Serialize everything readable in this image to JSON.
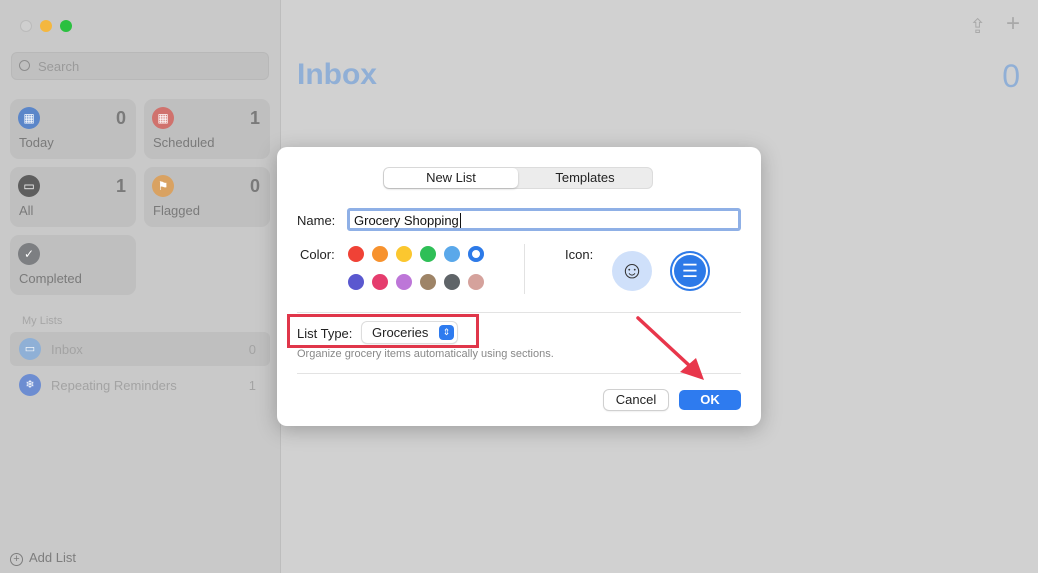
{
  "window": {
    "traffic_lights": [
      "#ff5f57",
      "#febc2e",
      "#28c840"
    ]
  },
  "sidebar": {
    "search_placeholder": "Search",
    "tiles": [
      {
        "label": "Today",
        "count": "0",
        "color": "#5b86c9",
        "icon": "calendar-today-icon"
      },
      {
        "label": "Scheduled",
        "count": "1",
        "color": "#d0726d",
        "icon": "calendar-icon"
      },
      {
        "label": "All",
        "count": "1",
        "color": "#5e5e5e",
        "icon": "tray-icon"
      },
      {
        "label": "Flagged",
        "count": "0",
        "color": "#d9a262",
        "icon": "flag-icon"
      },
      {
        "label": "Completed",
        "count": "",
        "color": "#7d7f82",
        "icon": "checkmark-icon"
      }
    ],
    "section_title": "My Lists",
    "lists": [
      {
        "label": "Inbox",
        "count": "0",
        "color": "#8fb0d6",
        "icon": "inbox-icon"
      },
      {
        "label": "Repeating Reminders",
        "count": "1",
        "color": "#6d8dd1",
        "icon": "snowflake-icon"
      }
    ],
    "add_list": "Add List"
  },
  "main": {
    "title": "Inbox",
    "count": "0"
  },
  "dialog": {
    "tabs": [
      "New List",
      "Templates"
    ],
    "name_label": "Name:",
    "name_value": "Grocery Shopping",
    "color_label": "Color:",
    "colors": [
      "#f04236",
      "#f7922e",
      "#fbc72f",
      "#2fbf57",
      "#5aa8ea",
      "#2d7ae8",
      "#5a58cf",
      "#e53d6e",
      "#bd76d8",
      "#9e8467",
      "#5f6468",
      "#d5a29c"
    ],
    "selected_color": "#2d7ae8",
    "icon_label": "Icon:",
    "icons": [
      "smiley-icon",
      "list-icon"
    ],
    "list_type_label": "List Type:",
    "list_type_value": "Groceries",
    "hint": "Organize grocery items automatically using sections.",
    "cancel": "Cancel",
    "ok": "OK"
  },
  "accent": "#2e7bef"
}
